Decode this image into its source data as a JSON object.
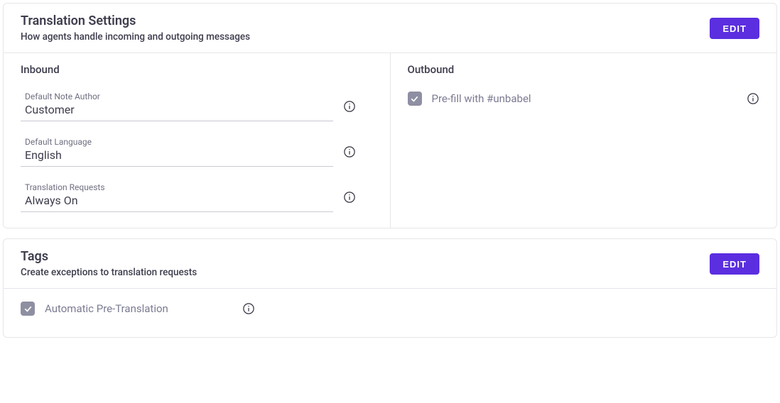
{
  "translationSettings": {
    "title": "Translation Settings",
    "subtitle": "How agents handle incoming and outgoing messages",
    "editLabel": "EDIT",
    "inbound": {
      "heading": "Inbound",
      "fields": [
        {
          "label": "Default Note Author",
          "value": "Customer"
        },
        {
          "label": "Default Language",
          "value": "English"
        },
        {
          "label": "Translation Requests",
          "value": "Always On"
        }
      ]
    },
    "outbound": {
      "heading": "Outbound",
      "prefill": {
        "label": "Pre-fill with #unbabel",
        "checked": true
      }
    }
  },
  "tags": {
    "title": "Tags",
    "subtitle": "Create exceptions to translation requests",
    "editLabel": "EDIT",
    "autoPretranslation": {
      "label": "Automatic Pre-Translation",
      "checked": true
    }
  }
}
